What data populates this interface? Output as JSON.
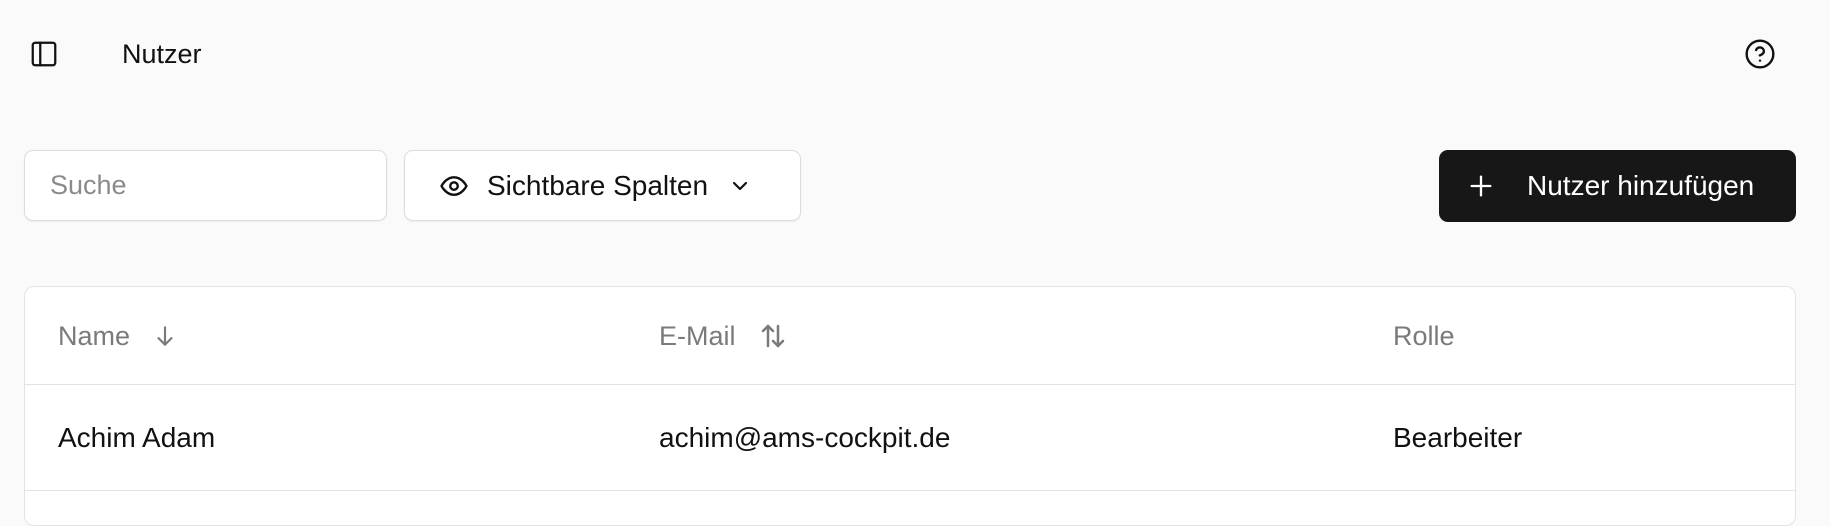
{
  "header": {
    "title": "Nutzer",
    "sidebar_toggle_icon": "sidebar-panel-icon",
    "help_icon": "help-circle-icon"
  },
  "toolbar": {
    "search": {
      "placeholder": "Suche",
      "value": ""
    },
    "columns_button": {
      "label": "Sichtbare Spalten",
      "icon": "eye-icon",
      "chevron": "chevron-down-icon"
    },
    "add_button": {
      "label": "Nutzer hinzufügen",
      "icon": "plus-icon"
    }
  },
  "table": {
    "columns": [
      {
        "label": "Name",
        "sort_icon": "arrow-down-icon"
      },
      {
        "label": "E-Mail",
        "sort_icon": "arrow-up-down-icon"
      },
      {
        "label": "Rolle"
      }
    ],
    "rows": [
      {
        "name": "Achim Adam",
        "email": "achim@ams-cockpit.de",
        "role": "Bearbeiter"
      }
    ]
  },
  "colors": {
    "background": "#fafafa",
    "primary_button": "#171717",
    "border": "#e3e3e3",
    "muted_text": "#7a7a7a"
  }
}
